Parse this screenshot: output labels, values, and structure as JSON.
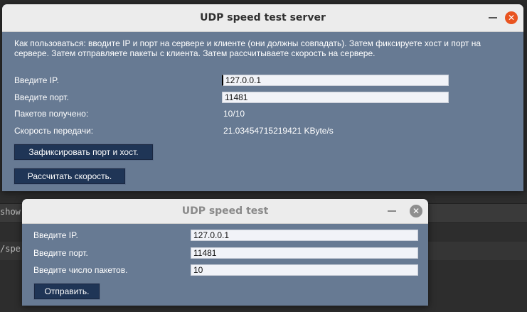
{
  "terminal": {
    "line1": "show",
    "line2": "/spe"
  },
  "server_window": {
    "title": "UDP speed test server",
    "description": "Как пользоваться: вводите IP и порт на сервере и клиенте (они должны совпадать). Затем фиксируете хост и порт на сервере. Затем отправляете пакеты с клиента. Затем рассчитываете скорость на сервере.",
    "ip_label": "Введите IP.",
    "ip_value": "127.0.0.1",
    "port_label": "Введите порт.",
    "port_value": "11481",
    "received_label": "Пакетов получено:",
    "received_value": "10/10",
    "speed_label": "Скорость передачи:",
    "speed_value": "21.03454715219421 KByte/s",
    "fix_button": "Зафиксировать порт и хост.",
    "calc_button": "Рассчитать скорость."
  },
  "client_window": {
    "title": "UDP speed test",
    "ip_label": "Введите IP.",
    "ip_value": "127.0.0.1",
    "port_label": "Введите порт.",
    "port_value": "11481",
    "count_label": "Введите число пакетов.",
    "count_value": "10",
    "send_button": "Отправить."
  },
  "icons": {
    "close": "close-icon",
    "minimize": "minimize-icon"
  },
  "colors": {
    "window_bg": "#677a93",
    "button_bg": "#1f3556",
    "close_active": "#e95420",
    "close_inactive": "#8e8e8e",
    "field_bg": "#f1f3f8"
  }
}
